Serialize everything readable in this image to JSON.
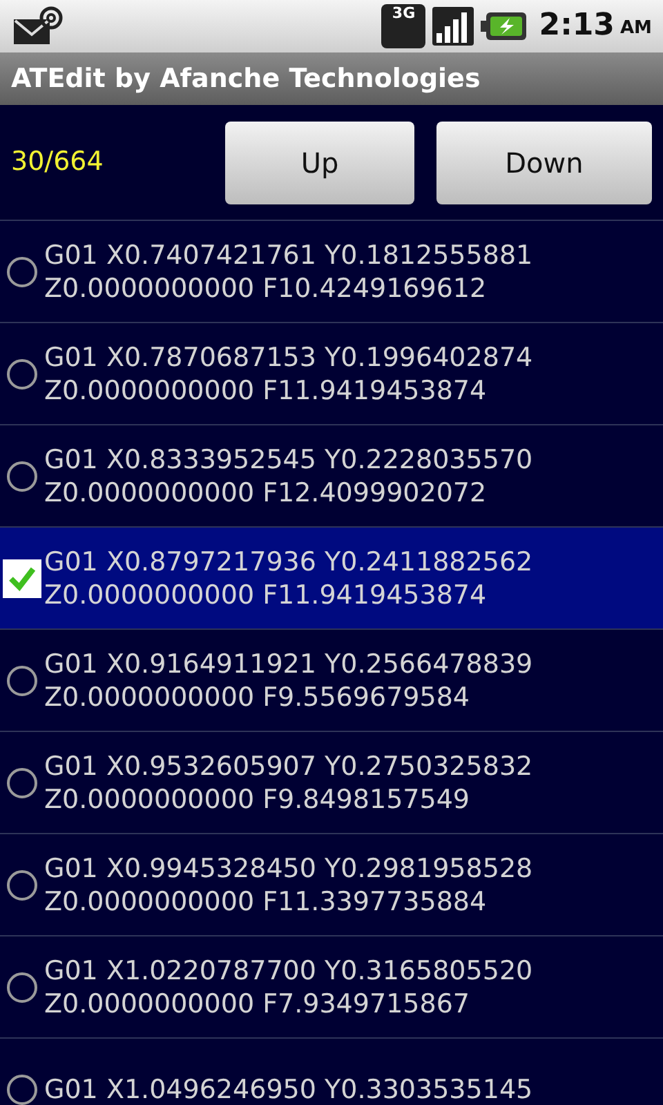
{
  "status_bar": {
    "network": "3G",
    "time": "2:13",
    "ampm": "AM"
  },
  "title": "ATEdit by Afanche Technologies",
  "toolbar": {
    "counter": "30/664",
    "buttons": [
      "Up",
      "Down"
    ]
  },
  "rows": [
    {
      "text": "G01 X0.7407421761 Y0.1812555881 Z0.0000000000 F10.4249169612",
      "selected": false
    },
    {
      "text": "G01 X0.7870687153 Y0.1996402874 Z0.0000000000 F11.9419453874",
      "selected": false
    },
    {
      "text": "G01 X0.8333952545 Y0.2228035570 Z0.0000000000 F12.4099902072",
      "selected": false
    },
    {
      "text": "G01 X0.8797217936 Y0.2411882562 Z0.0000000000 F11.9419453874",
      "selected": true
    },
    {
      "text": "G01 X0.9164911921 Y0.2566478839 Z0.0000000000 F9.5569679584",
      "selected": false
    },
    {
      "text": "G01 X0.9532605907 Y0.2750325832 Z0.0000000000 F9.8498157549",
      "selected": false
    },
    {
      "text": "G01 X0.9945328450 Y0.2981958528 Z0.0000000000 F11.3397735884",
      "selected": false
    },
    {
      "text": "G01 X1.0220787700 Y0.3165805520 Z0.0000000000 F7.9349715867",
      "selected": false
    },
    {
      "text": "G01 X1.0496246950 Y0.3303535145",
      "selected": false
    }
  ]
}
